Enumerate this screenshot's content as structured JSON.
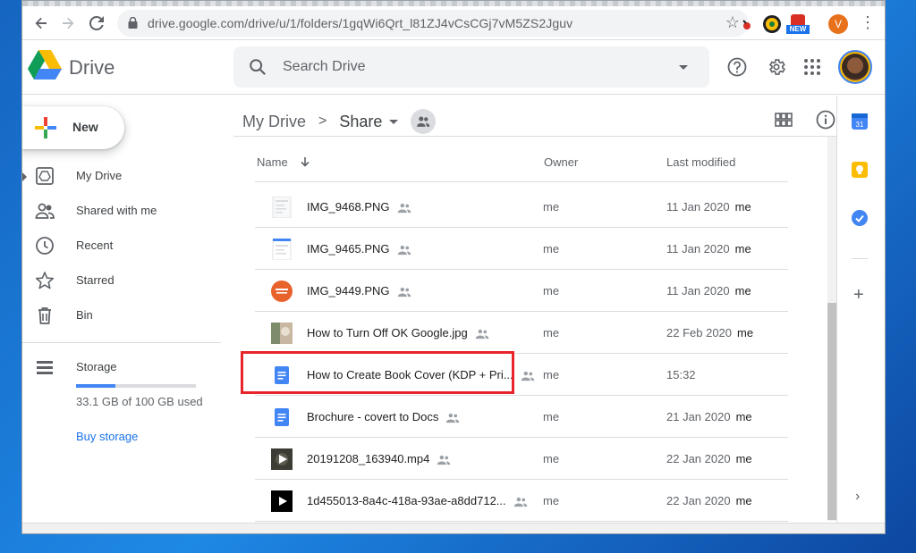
{
  "browser": {
    "url": "drive.google.com/drive/u/1/folders/1gqWi6Qrt_l81ZJ4vCsCGj7vM5ZS2Jguv",
    "new_badge": "NEW",
    "profile_letter": "V"
  },
  "header": {
    "app_name": "Drive",
    "search_placeholder": "Search Drive"
  },
  "sidebar": {
    "new_label": "New",
    "items": [
      {
        "label": "My Drive",
        "icon": "my-drive-icon"
      },
      {
        "label": "Shared with me",
        "icon": "shared-icon"
      },
      {
        "label": "Recent",
        "icon": "clock-icon"
      },
      {
        "label": "Starred",
        "icon": "star-icon"
      },
      {
        "label": "Bin",
        "icon": "trash-icon"
      },
      {
        "label": "Storage",
        "icon": "storage-icon"
      }
    ],
    "storage_used_fraction": 0.331,
    "storage_text": "33.1 GB of 100 GB used",
    "buy_storage": "Buy storage"
  },
  "breadcrumb": {
    "root": "My Drive",
    "current": "Share"
  },
  "columns": {
    "name": "Name",
    "owner": "Owner",
    "modified": "Last modified"
  },
  "files": [
    {
      "name": "IMG_9468.PNG",
      "owner": "me",
      "modified": "11 Jan 2020",
      "by": "me",
      "thumb": "image-thumb"
    },
    {
      "name": "IMG_9465.PNG",
      "owner": "me",
      "modified": "11 Jan 2020",
      "by": "me",
      "thumb": "image-thumb"
    },
    {
      "name": "IMG_9449.PNG",
      "owner": "me",
      "modified": "11 Jan 2020",
      "by": "me",
      "thumb": "itech-thumb"
    },
    {
      "name": "How to Turn Off OK Google.jpg",
      "owner": "me",
      "modified": "22 Feb 2020",
      "by": "me",
      "thumb": "photo-thumb"
    },
    {
      "name": "How to Create Book Cover (KDP + Pri...",
      "owner": "me",
      "modified": "15:32",
      "by": "",
      "thumb": "docs-icon"
    },
    {
      "name": "Brochure - covert to Docs",
      "owner": "me",
      "modified": "21 Jan 2020",
      "by": "me",
      "thumb": "docs-icon"
    },
    {
      "name": "20191208_163940.mp4",
      "owner": "me",
      "modified": "22 Jan 2020",
      "by": "me",
      "thumb": "video-thumb"
    },
    {
      "name": "1d455013-8a4c-418a-93ae-a8dd712...",
      "owner": "me",
      "modified": "22 Jan 2020",
      "by": "me",
      "thumb": "video-thumb"
    }
  ],
  "colors": {
    "accent": "#1a73e8",
    "highlight": "#e8252b",
    "docs_blue": "#4285f4"
  }
}
